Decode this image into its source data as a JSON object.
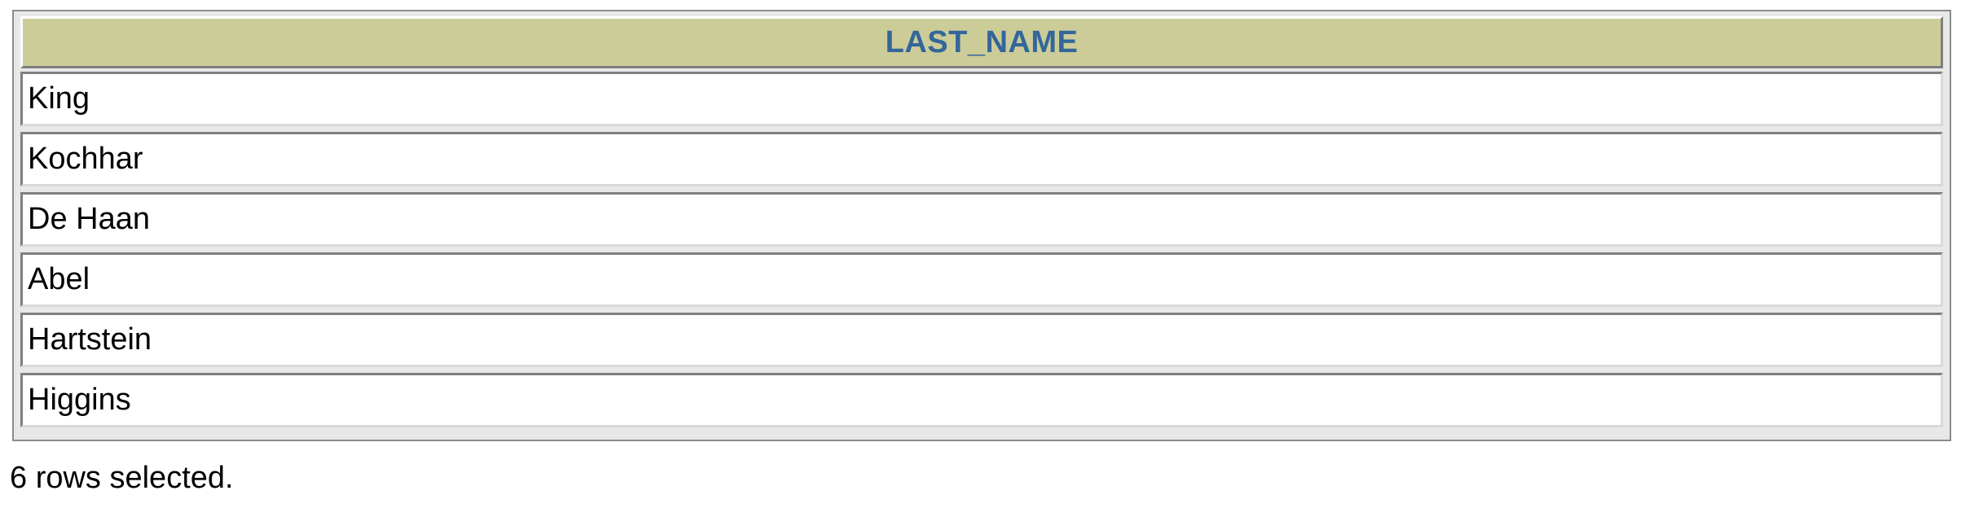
{
  "table": {
    "header": "LAST_NAME",
    "rows": [
      "King",
      "Kochhar",
      "De Haan",
      "Abel",
      "Hartstein",
      "Higgins"
    ]
  },
  "status": "6 rows selected.",
  "colors": {
    "header_bg": "#cccc99",
    "header_text": "#336699",
    "cell_bg": "#ffffff"
  }
}
